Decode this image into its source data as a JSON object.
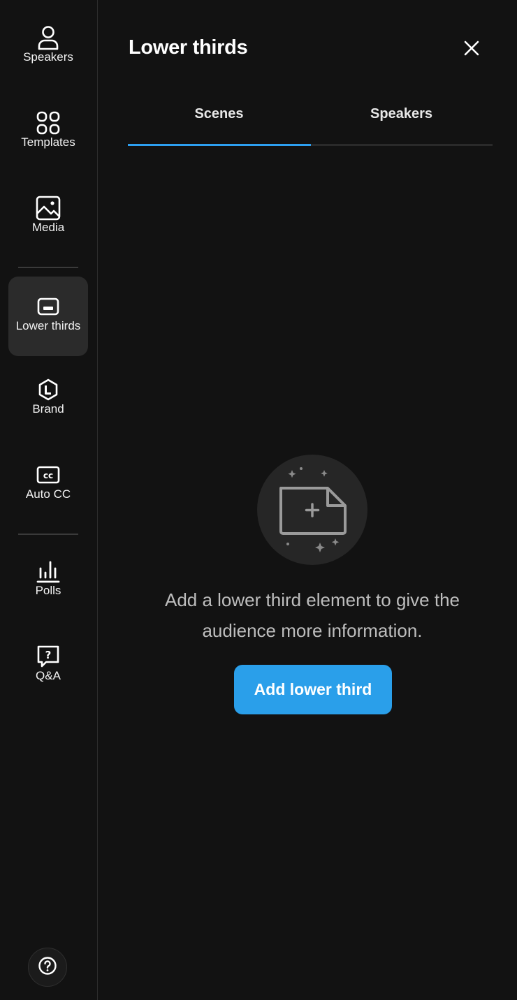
{
  "sidebar": {
    "items": [
      {
        "label": "Speakers",
        "icon": "person-icon"
      },
      {
        "label": "Templates",
        "icon": "grid-icon"
      },
      {
        "label": "Media",
        "icon": "image-icon"
      },
      {
        "label": "Lower thirds",
        "icon": "lower-thirds-icon",
        "active": true
      },
      {
        "label": "Brand",
        "icon": "brand-icon"
      },
      {
        "label": "Auto CC",
        "icon": "cc-icon"
      },
      {
        "label": "Polls",
        "icon": "poll-chart-icon"
      },
      {
        "label": "Q&A",
        "icon": "qa-icon"
      }
    ],
    "help_icon": "help-icon"
  },
  "panel": {
    "title": "Lower thirds",
    "close_icon": "close-icon",
    "tabs": [
      {
        "label": "Scenes",
        "active": true
      },
      {
        "label": "Speakers",
        "active": false
      }
    ],
    "empty_state": {
      "icon": "add-file-sparkle-icon",
      "message": "Add a lower third element to give the audience more information.",
      "button_label": "Add lower third"
    }
  },
  "colors": {
    "background": "#121212",
    "accent": "#2a9fea",
    "active_nav_bg": "#2b2b2b"
  }
}
